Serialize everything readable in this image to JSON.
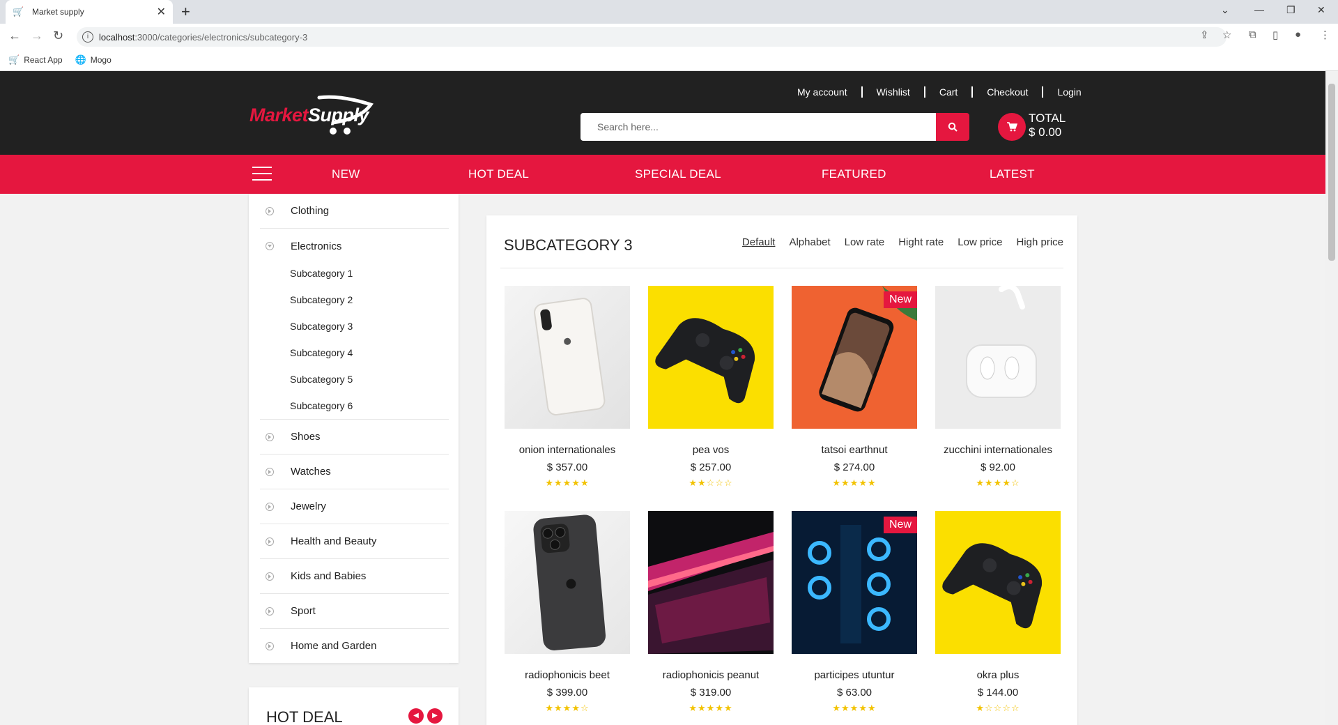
{
  "browser": {
    "tab_title": "Market supply",
    "url_host": "localhost",
    "url_path": ":3000/categories/electronics/subcategory-3",
    "bookmarks": [
      {
        "label": "React App",
        "icon": "react-icon"
      },
      {
        "label": "Mogo",
        "icon": "globe-icon"
      }
    ]
  },
  "header": {
    "logo_market": "Market",
    "logo_supply": "Supply",
    "links": [
      "My account",
      "Wishlist",
      "Cart",
      "Checkout",
      "Login"
    ],
    "search_placeholder": "Search here...",
    "total_label": "TOTAL",
    "total_value": "$ 0.00",
    "accent_color": "#e5173f",
    "dark_color": "#212121"
  },
  "nav": {
    "items": [
      "NEW",
      "HOT DEAL",
      "SPECIAL DEAL",
      "FEATURED",
      "LATEST"
    ]
  },
  "sidebar": {
    "categories": [
      "Clothing",
      "Electronics",
      "Shoes",
      "Watches",
      "Jewelry",
      "Health and Beauty",
      "Kids and Babies",
      "Sport",
      "Home and Garden"
    ],
    "subcategories": [
      "Subcategory 1",
      "Subcategory 2",
      "Subcategory 3",
      "Subcategory 4",
      "Subcategory 5",
      "Subcategory 6"
    ],
    "hot_deal_title": "HOT DEAL"
  },
  "main": {
    "title": "SUBCATEGORY 3",
    "sort_options": [
      "Default",
      "Alphabet",
      "Low rate",
      "Hight rate",
      "Low price",
      "High price"
    ],
    "active_sort": "Default",
    "products": [
      {
        "name": "onion internationales",
        "price": "$ 357.00",
        "rating": 5,
        "badge": "",
        "image": "white-iphone"
      },
      {
        "name": "pea vos",
        "price": "$ 257.00",
        "rating": 2,
        "badge": "",
        "image": "xbox-controller-yellow"
      },
      {
        "name": "tatsoi earthnut",
        "price": "$ 274.00",
        "rating": 5,
        "badge": "New",
        "image": "iphone-orange"
      },
      {
        "name": "zucchini internationales",
        "price": "$ 92.00",
        "rating": 4,
        "badge": "",
        "image": "airpods"
      },
      {
        "name": "radiophonicis beet",
        "price": "$ 399.00",
        "rating": 4,
        "badge": "",
        "image": "iphone-11-pro"
      },
      {
        "name": "radiophonicis peanut",
        "price": "$ 319.00",
        "rating": 5,
        "badge": "",
        "image": "laptop-pink"
      },
      {
        "name": "participes utuntur",
        "price": "$ 63.00",
        "rating": 5,
        "badge": "New",
        "image": "gaming-pc"
      },
      {
        "name": "okra plus",
        "price": "$ 144.00",
        "rating": 1,
        "badge": "",
        "image": "xbox-controller-yellow"
      }
    ]
  }
}
